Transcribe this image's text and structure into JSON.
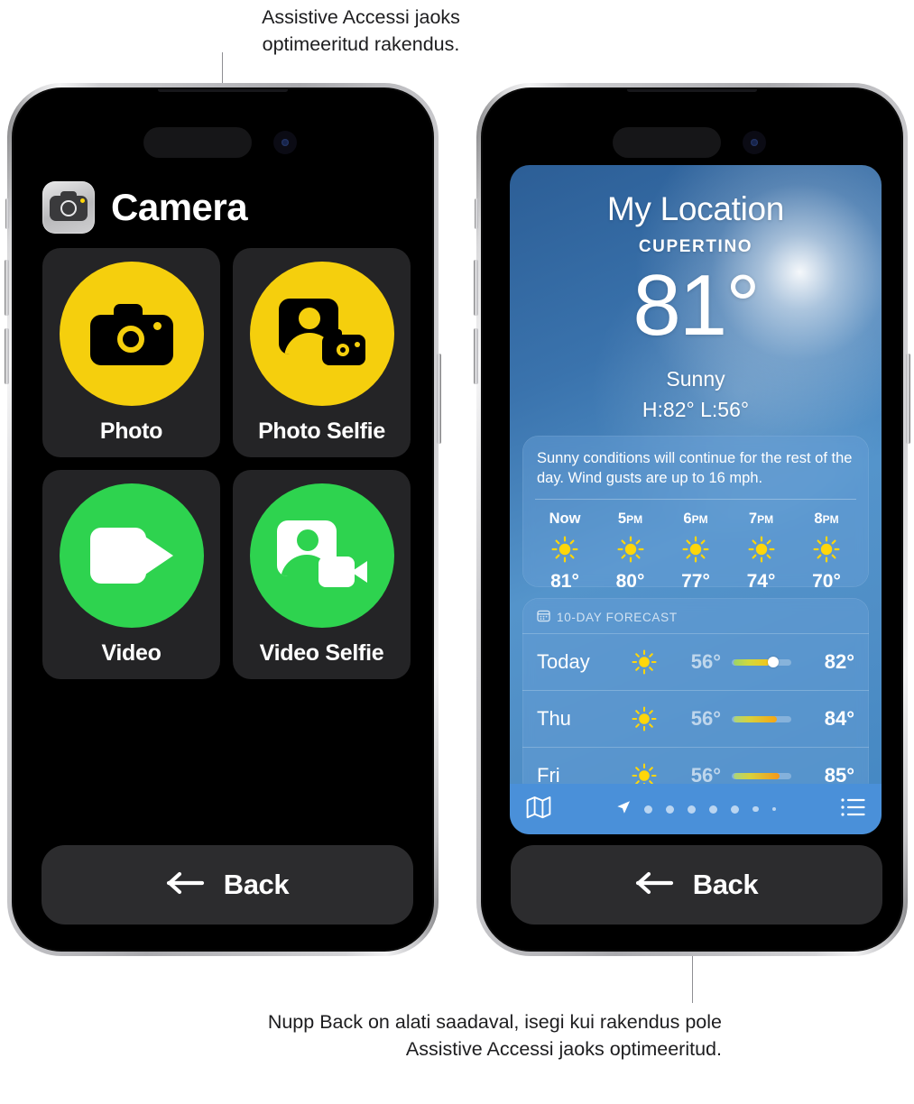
{
  "captions": {
    "top": "Assistive Accessi jaoks optimeeritud rakendus.",
    "bottom": "Nupp Back on alati saadaval, isegi kui rakendus pole Assistive Accessi jaoks optimeeritud."
  },
  "colors": {
    "photo_accent": "#f5cf0d",
    "video_accent": "#2ed34f",
    "tile_bg": "#242426",
    "back_button_bg": "#2c2c2e",
    "weather_toolbar": "#4a90d9"
  },
  "camera_app": {
    "title": "Camera",
    "icon": "camera-app-icon",
    "tiles": [
      {
        "label": "Photo",
        "icon": "camera-icon",
        "accent": "#f5cf0d"
      },
      {
        "label": "Photo Selfie",
        "icon": "camera-selfie-icon",
        "accent": "#f5cf0d"
      },
      {
        "label": "Video",
        "icon": "video-icon",
        "accent": "#2ed34f"
      },
      {
        "label": "Video Selfie",
        "icon": "video-selfie-icon",
        "accent": "#2ed34f"
      }
    ],
    "back_button": {
      "label": "Back",
      "icon": "arrow-left-icon"
    }
  },
  "weather_app": {
    "location": "My Location",
    "city": "CUPERTINO",
    "temperature": "81°",
    "condition": "Sunny",
    "high_low": "H:82°  L:56°",
    "summary": "Sunny conditions will continue for the rest of the day. Wind gusts are up to 16 mph.",
    "hourly": [
      {
        "time": "Now",
        "suffix": "",
        "icon": "sun-icon",
        "temp": "81°"
      },
      {
        "time": "5",
        "suffix": "PM",
        "icon": "sun-icon",
        "temp": "80°"
      },
      {
        "time": "6",
        "suffix": "PM",
        "icon": "sun-icon",
        "temp": "77°"
      },
      {
        "time": "7",
        "suffix": "PM",
        "icon": "sun-icon",
        "temp": "74°"
      },
      {
        "time": "8",
        "suffix": "PM",
        "icon": "sun-icon",
        "temp": "70°"
      }
    ],
    "tenday": {
      "header": "10-DAY FORECAST",
      "header_icon": "calendar-icon",
      "days": [
        {
          "name": "Today",
          "icon": "sun-icon",
          "low": "56°",
          "high": "82°",
          "bar_start": 3,
          "bar_end": 64,
          "knob": 63
        },
        {
          "name": "Thu",
          "icon": "sun-icon",
          "low": "56°",
          "high": "84°",
          "bar_start": 3,
          "bar_end": 76,
          "knob": null
        },
        {
          "name": "Fri",
          "icon": "sun-icon",
          "low": "56°",
          "high": "85°",
          "bar_start": 3,
          "bar_end": 80,
          "knob": null
        }
      ]
    },
    "toolbar": {
      "map_icon": "map-icon",
      "list_icon": "list-icon",
      "current_page_icon": "location-arrow-icon",
      "page_dots": 7
    },
    "back_button": {
      "label": "Back",
      "icon": "arrow-left-icon"
    }
  }
}
